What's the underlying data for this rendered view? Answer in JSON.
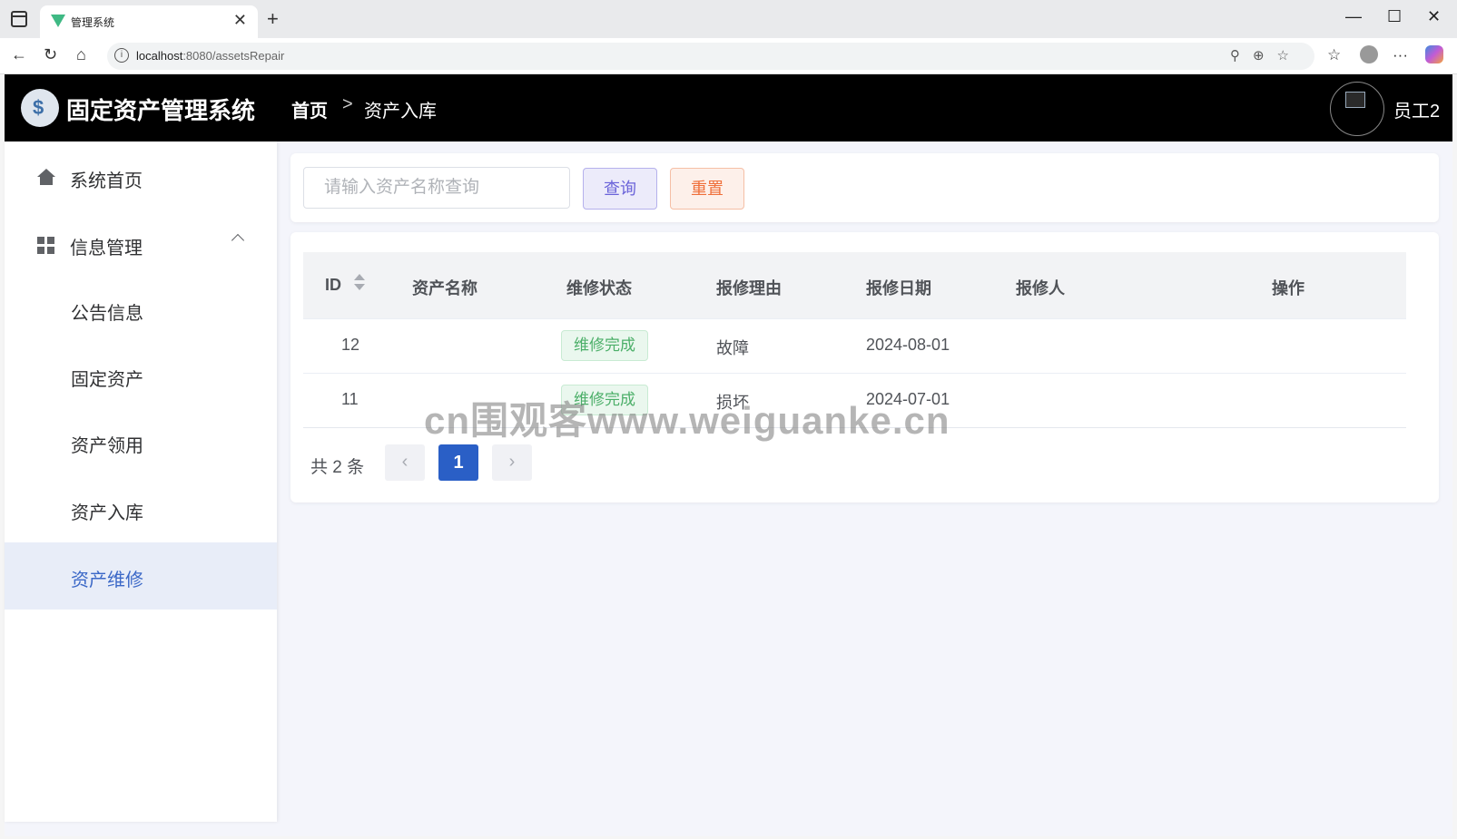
{
  "browser": {
    "tab_title": "管理系统",
    "tab_close": "✕",
    "new_tab": "+",
    "win_min": "—",
    "win_max": "☐",
    "win_close": "✕",
    "url_host": "localhost",
    "url_rest": ":8080/assetsRepair",
    "back": "←",
    "reload": "↻",
    "home": "⌂",
    "url_icons": "⚲⊕☆",
    "fav": "☆",
    "menu": "···"
  },
  "header": {
    "title": "固定资产管理系统",
    "breadcrumb": [
      "首页",
      "资产入库"
    ],
    "separator": ">",
    "username": "员工2"
  },
  "sidebar": {
    "items": [
      {
        "label": "系统首页",
        "icon": "home-icon"
      },
      {
        "label": "信息管理",
        "icon": "grid-icon",
        "expanded": true
      },
      {
        "label": "公告信息"
      },
      {
        "label": "固定资产"
      },
      {
        "label": "资产领用"
      },
      {
        "label": "资产入库"
      },
      {
        "label": "资产维修",
        "active": true
      }
    ]
  },
  "search": {
    "placeholder": "请输入资产名称查询",
    "value": "",
    "query_label": "查询",
    "reset_label": "重置"
  },
  "table": {
    "columns": [
      "ID",
      "资产名称",
      "维修状态",
      "报修理由",
      "报修日期",
      "报修人",
      "操作"
    ],
    "rows": [
      {
        "id": "12",
        "name": "",
        "status": "维修完成",
        "reason": "故障",
        "date": "2024-08-01",
        "reporter": ""
      },
      {
        "id": "11",
        "name": "",
        "status": "维修完成",
        "reason": "损坏",
        "date": "2024-07-01",
        "reporter": ""
      }
    ]
  },
  "pagination": {
    "total": "共 2 条",
    "current": "1",
    "prev": "‹",
    "next": "›"
  },
  "watermark": "cn围观客www.weiguanke.cn"
}
